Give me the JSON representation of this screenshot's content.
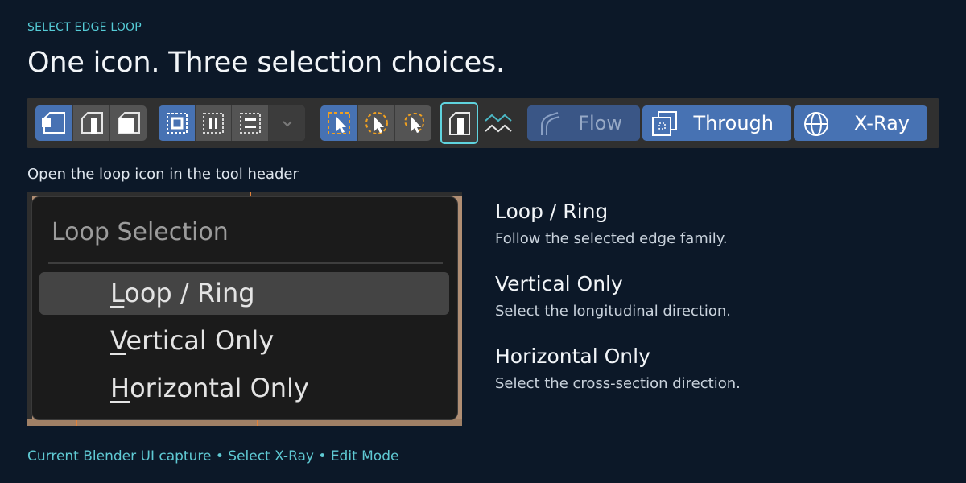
{
  "eyebrow": "SELECT EDGE LOOP",
  "headline": "One icon. Three selection choices.",
  "toolbar": {
    "select_mode_icons": [
      "vertex-select-icon",
      "edge-select-icon",
      "face-select-icon"
    ],
    "box_mode_icons": [
      "box-set-icon",
      "box-extend-icon",
      "box-subtract-icon",
      "dropdown-chevron-icon"
    ],
    "cursor_mode_icons": [
      "select-box-cursor-icon",
      "select-circle-cursor-icon",
      "select-lasso-cursor-icon"
    ],
    "loop_icon": "edge-loop-icon",
    "ring_icon": "edge-ring-icon",
    "flow_label": "Flow",
    "through_label": "Through",
    "xray_label": "X-Ray",
    "accent": "#4772b3",
    "highlight": "#5fd3de"
  },
  "intro": "Open the loop icon in the tool header",
  "popup": {
    "title": "Loop Selection",
    "items": [
      {
        "mnemonic": "L",
        "rest": "oop / Ring",
        "hover": true
      },
      {
        "mnemonic": "V",
        "rest": "ertical Only",
        "hover": false
      },
      {
        "mnemonic": "H",
        "rest": "orizontal Only",
        "hover": false
      }
    ]
  },
  "options": [
    {
      "title": "Loop / Ring",
      "desc": "Follow the selected edge family."
    },
    {
      "title": "Vertical Only",
      "desc": "Select the longitudinal direction."
    },
    {
      "title": "Horizontal Only",
      "desc": "Select the cross-section direction."
    }
  ],
  "footer": "Current Blender UI capture • Select X-Ray • Edit Mode"
}
